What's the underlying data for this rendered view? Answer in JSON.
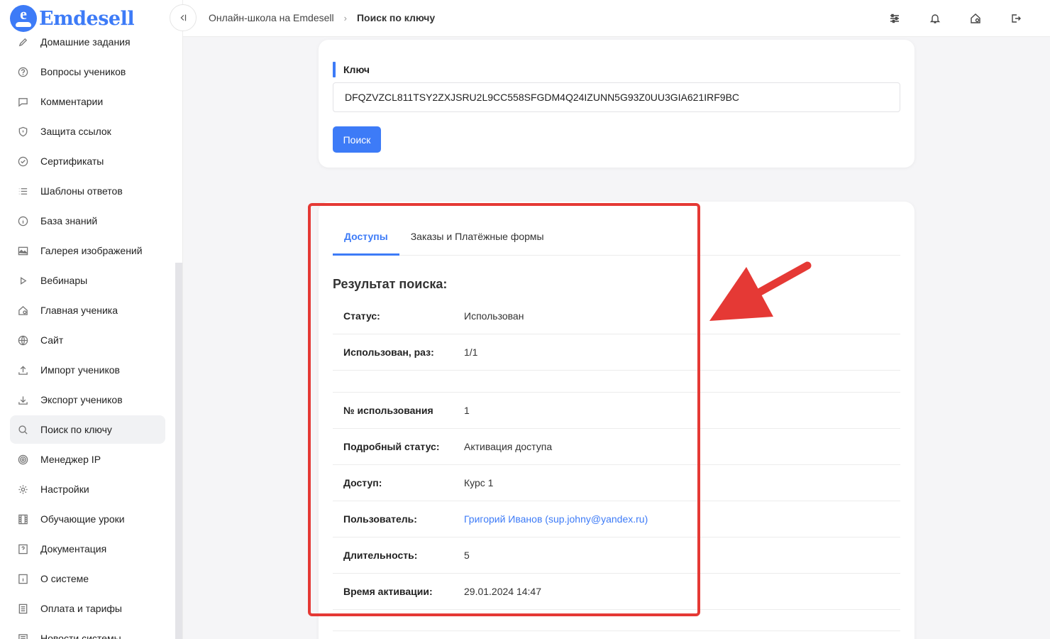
{
  "brand": {
    "logo_letter": "e",
    "name": "Emdesell",
    "accent": "#3d7bf7"
  },
  "sidebar": {
    "items": [
      {
        "label": "Домашние задания",
        "icon": "pencil-icon"
      },
      {
        "label": "Вопросы учеников",
        "icon": "question-circle-icon"
      },
      {
        "label": "Комментарии",
        "icon": "comment-icon"
      },
      {
        "label": "Защита ссылок",
        "icon": "shield-icon"
      },
      {
        "label": "Сертификаты",
        "icon": "check-circle-icon"
      },
      {
        "label": "Шаблоны ответов",
        "icon": "list-icon"
      },
      {
        "label": "База знаний",
        "icon": "info-circle-icon"
      },
      {
        "label": "Галерея изображений",
        "icon": "image-icon"
      },
      {
        "label": "Вебинары",
        "icon": "play-icon"
      },
      {
        "label": "Главная ученика",
        "icon": "home-icon"
      },
      {
        "label": "Сайт",
        "icon": "globe-icon"
      },
      {
        "label": "Импорт учеников",
        "icon": "upload-icon"
      },
      {
        "label": "Экспорт учеников",
        "icon": "download-icon"
      },
      {
        "label": "Поиск по ключу",
        "icon": "search-icon",
        "active": true
      },
      {
        "label": "Менеджер IP",
        "icon": "target-icon"
      },
      {
        "label": "Настройки",
        "icon": "gear-icon"
      },
      {
        "label": "Обучающие уроки",
        "icon": "film-icon"
      },
      {
        "label": "Документация",
        "icon": "doc-question-icon"
      },
      {
        "label": "О системе",
        "icon": "info-square-icon"
      },
      {
        "label": "Оплата и тарифы",
        "icon": "receipt-icon"
      },
      {
        "label": "Новости системы",
        "icon": "news-icon"
      }
    ]
  },
  "topbar": {
    "breadcrumb": {
      "parent": "Онлайн-школа на Emdesell",
      "current": "Поиск по ключу"
    }
  },
  "search_form": {
    "key_label": "Ключ",
    "key_value": "DFQZVZCL811TSY2ZXJSRU2L9CC558SFGDM4Q24IZUNN5G93Z0UU3GIA621IRF9BC",
    "search_button": "Поиск"
  },
  "results": {
    "tabs": [
      {
        "label": "Доступы",
        "active": true
      },
      {
        "label": "Заказы и Платёжные формы",
        "active": false
      }
    ],
    "title": "Результат поиска:",
    "rows_top": [
      {
        "key": "Статус:",
        "value": "Использован"
      },
      {
        "key": "Использован, раз:",
        "value": "1/1"
      }
    ],
    "rows": [
      {
        "key": "№ использования",
        "value": "1"
      },
      {
        "key": "Подробный статус:",
        "value": "Активация доступа"
      },
      {
        "key": "Доступ:",
        "value": "Курс 1"
      },
      {
        "key": "Пользователь:",
        "value": "Григорий Иванов (sup.johny@yandex.ru)",
        "link": true
      },
      {
        "key": "Длительность:",
        "value": "5"
      },
      {
        "key": "Время активации:",
        "value": "29.01.2024 14:47"
      }
    ]
  },
  "annotation_color": "#e53935"
}
